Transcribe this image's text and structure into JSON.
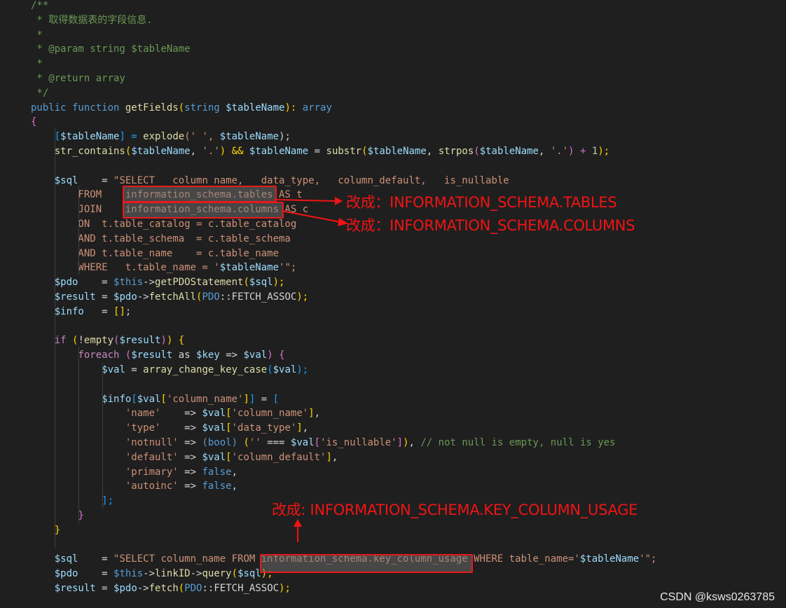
{
  "colors": {
    "background": "#1f1f1f",
    "comment": "#6a9955",
    "keyword": "#569cd6",
    "control": "#c586c0",
    "function": "#dcdcaa",
    "variable": "#9cdcfe",
    "string": "#ce9178",
    "number": "#b5cea8",
    "constant": "#569cd6",
    "bracket_gold": "#ffd700",
    "bracket_purple": "#da70d6",
    "bracket_blue": "#179fff",
    "annotation_red": "#f01414"
  },
  "code_lines": [
    [
      [
        "/**",
        "c"
      ]
    ],
    [
      [
        " * 取得数据表的字段信息.",
        "c"
      ]
    ],
    [
      [
        " *",
        "c"
      ]
    ],
    [
      [
        " * @param string $tableName",
        "c"
      ]
    ],
    [
      [
        " *",
        "c"
      ]
    ],
    [
      [
        " * @return array",
        "c"
      ]
    ],
    [
      [
        " */",
        "c"
      ]
    ],
    [
      [
        "public function ",
        "k"
      ],
      [
        "getFields",
        "f"
      ],
      [
        "(",
        "b1"
      ],
      [
        "string ",
        "k"
      ],
      [
        "$tableName",
        "v"
      ],
      [
        "): ",
        "b1"
      ],
      [
        "array",
        "k"
      ]
    ],
    [
      [
        "{",
        "b2"
      ]
    ],
    [
      [
        "    ",
        ""
      ],
      [
        "[",
        "b3"
      ],
      [
        "$tableName",
        "v"
      ],
      [
        "] = ",
        "b3"
      ],
      [
        "explode",
        "f"
      ],
      [
        "(' ', ",
        "s"
      ],
      [
        "$tableName",
        "v"
      ],
      [
        ");",
        ""
      ]
    ],
    [
      [
        "    ",
        ""
      ],
      [
        "str_contains",
        "f"
      ],
      [
        "(",
        "b1"
      ],
      [
        "$tableName",
        "v"
      ],
      [
        ", ",
        "t"
      ],
      [
        "'.'",
        "s"
      ],
      [
        ") && ",
        "b1"
      ],
      [
        "$tableName",
        "v"
      ],
      [
        " = ",
        ""
      ],
      [
        "substr",
        "f"
      ],
      [
        "(",
        "b1"
      ],
      [
        "$tableName",
        "v"
      ],
      [
        ", ",
        "t"
      ],
      [
        "strpos",
        "f"
      ],
      [
        "(",
        "b2"
      ],
      [
        "$tableName",
        "v"
      ],
      [
        ", ",
        "t"
      ],
      [
        "'.'",
        "s"
      ],
      [
        ") + ",
        "b2"
      ],
      [
        "1",
        "n"
      ],
      [
        ");",
        "b1"
      ]
    ],
    [
      [
        "",
        ""
      ]
    ],
    [
      [
        "    ",
        ""
      ],
      [
        "$sql",
        "v"
      ],
      [
        "    = ",
        ""
      ],
      [
        "\"SELECT   column_name,   data_type,   column_default,   is_nullable",
        "s"
      ]
    ],
    [
      [
        "        FROM    information_schema.tables AS t",
        "s"
      ]
    ],
    [
      [
        "        JOIN    information_schema.columns AS c",
        "s"
      ]
    ],
    [
      [
        "        ON  t.table_catalog = c.table_catalog",
        "s"
      ]
    ],
    [
      [
        "        AND t.table_schema  = c.table_schema",
        "s"
      ]
    ],
    [
      [
        "        AND t.table_name    = c.table_name",
        "s"
      ]
    ],
    [
      [
        "        WHERE   t.table_name = '",
        "s"
      ],
      [
        "$tableName",
        "v"
      ],
      [
        "'\";",
        "s"
      ]
    ],
    [
      [
        "    ",
        ""
      ],
      [
        "$pdo",
        "v"
      ],
      [
        "    = ",
        ""
      ],
      [
        "$this",
        "k"
      ],
      [
        "->",
        ""
      ],
      [
        "getPDOStatement",
        "f"
      ],
      [
        "(",
        "b1"
      ],
      [
        "$sql",
        "v"
      ],
      [
        ");",
        "b1"
      ]
    ],
    [
      [
        "    ",
        ""
      ],
      [
        "$result",
        "v"
      ],
      [
        " = ",
        ""
      ],
      [
        "$pdo",
        "v"
      ],
      [
        "->",
        ""
      ],
      [
        "fetchAll",
        "f"
      ],
      [
        "(",
        "b1"
      ],
      [
        "PDO",
        "k"
      ],
      [
        "::FETCH_ASSOC",
        "t"
      ],
      [
        ");",
        "b1"
      ]
    ],
    [
      [
        "    ",
        ""
      ],
      [
        "$info",
        "v"
      ],
      [
        "   = ",
        ""
      ],
      [
        "[]",
        "b1"
      ],
      [
        ";",
        ""
      ]
    ],
    [
      [
        "",
        ""
      ]
    ],
    [
      [
        "    ",
        ""
      ],
      [
        "if ",
        "x"
      ],
      [
        "(",
        "b1"
      ],
      [
        "!",
        "t"
      ],
      [
        "empty",
        "f"
      ],
      [
        "(",
        "b2"
      ],
      [
        "$result",
        "v"
      ],
      [
        ")",
        "b2"
      ],
      [
        ") ",
        "b1"
      ],
      [
        "{",
        "b1"
      ]
    ],
    [
      [
        "        ",
        ""
      ],
      [
        "foreach ",
        "x"
      ],
      [
        "(",
        "b2"
      ],
      [
        "$result",
        "v"
      ],
      [
        " as ",
        "t"
      ],
      [
        "$key",
        "v"
      ],
      [
        " => ",
        "t"
      ],
      [
        "$val",
        "v"
      ],
      [
        ") ",
        "b2"
      ],
      [
        "{",
        "b2"
      ]
    ],
    [
      [
        "            ",
        ""
      ],
      [
        "$val",
        "v"
      ],
      [
        " = ",
        ""
      ],
      [
        "array_change_key_case",
        "f"
      ],
      [
        "(",
        "b3"
      ],
      [
        "$val",
        "v"
      ],
      [
        ");",
        "b3"
      ]
    ],
    [
      [
        "",
        ""
      ]
    ],
    [
      [
        "            ",
        ""
      ],
      [
        "$info",
        "v"
      ],
      [
        "[",
        "b3"
      ],
      [
        "$val",
        "v"
      ],
      [
        "[",
        "b1"
      ],
      [
        "'column_name'",
        "s"
      ],
      [
        "]",
        "b1"
      ],
      [
        "]",
        "b3"
      ],
      [
        " = ",
        ""
      ],
      [
        "[",
        "b3"
      ]
    ],
    [
      [
        "                ",
        ""
      ],
      [
        "'name'",
        "s"
      ],
      [
        "    => ",
        ""
      ],
      [
        "$val",
        "v"
      ],
      [
        "[",
        "b1"
      ],
      [
        "'column_name'",
        "s"
      ],
      [
        "]",
        "b1"
      ],
      [
        ",",
        ""
      ]
    ],
    [
      [
        "                ",
        ""
      ],
      [
        "'type'",
        "s"
      ],
      [
        "    => ",
        ""
      ],
      [
        "$val",
        "v"
      ],
      [
        "[",
        "b1"
      ],
      [
        "'data_type'",
        "s"
      ],
      [
        "]",
        "b1"
      ],
      [
        ",",
        ""
      ]
    ],
    [
      [
        "                ",
        ""
      ],
      [
        "'notnull'",
        "s"
      ],
      [
        " => ",
        ""
      ],
      [
        "(bool) ",
        "k"
      ],
      [
        "(",
        "b1"
      ],
      [
        "'' ",
        "s"
      ],
      [
        "=== ",
        ""
      ],
      [
        "$val",
        "v"
      ],
      [
        "[",
        "b2"
      ],
      [
        "'is_nullable'",
        "s"
      ],
      [
        "]",
        "b2"
      ],
      [
        ")",
        "b1"
      ],
      [
        ", ",
        ""
      ],
      [
        "// not null is empty, null is yes",
        "c"
      ]
    ],
    [
      [
        "                ",
        ""
      ],
      [
        "'default'",
        "s"
      ],
      [
        " => ",
        ""
      ],
      [
        "$val",
        "v"
      ],
      [
        "[",
        "b1"
      ],
      [
        "'column_default'",
        "s"
      ],
      [
        "]",
        "b1"
      ],
      [
        ",",
        ""
      ]
    ],
    [
      [
        "                ",
        ""
      ],
      [
        "'primary'",
        "s"
      ],
      [
        " => ",
        ""
      ],
      [
        "false",
        "k"
      ],
      [
        ",",
        ""
      ]
    ],
    [
      [
        "                ",
        ""
      ],
      [
        "'autoinc'",
        "s"
      ],
      [
        " => ",
        ""
      ],
      [
        "false",
        "k"
      ],
      [
        ",",
        ""
      ]
    ],
    [
      [
        "            ",
        ""
      ],
      [
        "];",
        "b3"
      ]
    ],
    [
      [
        "        ",
        ""
      ],
      [
        "}",
        "b2"
      ]
    ],
    [
      [
        "    ",
        ""
      ],
      [
        "}",
        "b1"
      ]
    ],
    [
      [
        "",
        ""
      ]
    ],
    [
      [
        "    ",
        ""
      ],
      [
        "$sql",
        "v"
      ],
      [
        "    = ",
        ""
      ],
      [
        "\"SELECT column_name FROM information_schema.key_column_usage WHERE table_name='",
        "s"
      ],
      [
        "$tableName",
        "v"
      ],
      [
        "'\";",
        "s"
      ]
    ],
    [
      [
        "    ",
        ""
      ],
      [
        "$pdo",
        "v"
      ],
      [
        "    = ",
        ""
      ],
      [
        "$this",
        "k"
      ],
      [
        "->",
        ""
      ],
      [
        "linkID",
        "f"
      ],
      [
        "->",
        ""
      ],
      [
        "query",
        "f"
      ],
      [
        "(",
        "b1"
      ],
      [
        "$sql",
        "v"
      ],
      [
        ");",
        "b1"
      ]
    ],
    [
      [
        "    ",
        ""
      ],
      [
        "$result",
        "v"
      ],
      [
        " = ",
        ""
      ],
      [
        "$pdo",
        "v"
      ],
      [
        "->",
        ""
      ],
      [
        "fetch",
        "f"
      ],
      [
        "(",
        "b1"
      ],
      [
        "PDO",
        "k"
      ],
      [
        "::FETCH_ASSOC",
        "t"
      ],
      [
        ");",
        "b1"
      ]
    ]
  ],
  "annotations": {
    "tables": "改成：INFORMATION_SCHEMA.TABLES",
    "columns": "改成：INFORMATION_SCHEMA.COLUMNS",
    "key_column_usage": "改成: INFORMATION_SCHEMA.KEY_COLUMN_USAGE"
  },
  "watermark": "CSDN @ksws0263785"
}
